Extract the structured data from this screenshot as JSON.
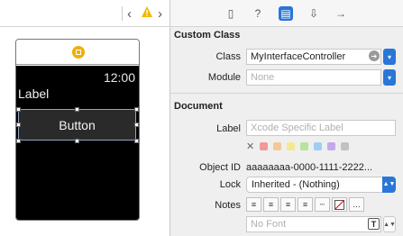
{
  "canvas_bar": {
    "back_glyph": "‹",
    "forward_glyph": "›",
    "warning_icon": "warning-triangle"
  },
  "watch": {
    "time": "12:00",
    "label": "Label",
    "button": "Button"
  },
  "inspector_tabs": [
    {
      "icon": "file-icon",
      "glyph": "▯"
    },
    {
      "icon": "help-icon",
      "glyph": "?"
    },
    {
      "icon": "identity-icon",
      "glyph": "▤"
    },
    {
      "icon": "attributes-icon",
      "glyph": "⇩"
    },
    {
      "icon": "connections-icon",
      "glyph": "→"
    }
  ],
  "custom_class": {
    "title": "Custom Class",
    "class_label": "Class",
    "class_value": "MyInterfaceController",
    "module_label": "Module",
    "module_placeholder": "None"
  },
  "document": {
    "title": "Document",
    "label_label": "Label",
    "label_placeholder": "Xcode Specific Label",
    "object_id_label": "Object ID",
    "object_id_value": "aaaaaaaa-0000-1111-2222...",
    "lock_label": "Lock",
    "lock_value": "Inherited - (Nothing)",
    "notes_label": "Notes",
    "font_placeholder": "No Font"
  },
  "colors": {
    "accent": "#2a76d8",
    "swatches": [
      "#f29a9a",
      "#f5c89a",
      "#f2ea8f",
      "#b8e39a",
      "#9ecff2",
      "#c3a9ec",
      "#c2c2c2"
    ]
  }
}
